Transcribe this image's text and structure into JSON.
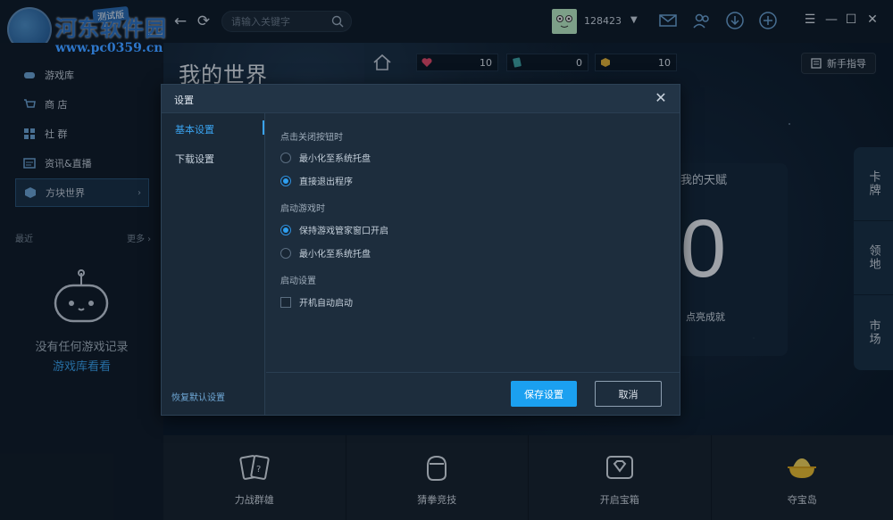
{
  "header": {
    "watermark": "河东软件园",
    "watermark_url": "www.pc0359.cn",
    "beta_tag": "测试版",
    "search_placeholder": "请输入关键字",
    "user_id": "128423"
  },
  "sidebar": {
    "items": [
      {
        "label": "游戏库",
        "icon": "gamepad-icon"
      },
      {
        "label": "商 店",
        "icon": "cart-icon"
      },
      {
        "label": "社 群",
        "icon": "community-icon"
      },
      {
        "label": "资讯&直播",
        "icon": "news-icon"
      },
      {
        "label": "方块世界",
        "icon": "cube-icon",
        "active": true
      }
    ],
    "recent_title": "最近",
    "recent_more": "更多 ›",
    "empty_text": "没有任何游戏记录",
    "empty_link": "游戏库看看"
  },
  "main": {
    "game_title": "我的世界",
    "resources": [
      {
        "icon": "heart-icon",
        "value": "10",
        "color": "#e84a6a"
      },
      {
        "icon": "card-gem-icon",
        "value": "0",
        "color": "#3fa6a6"
      },
      {
        "icon": "gold-block-icon",
        "value": "10",
        "color": "#e8b536"
      }
    ],
    "guide_label": "新手指导",
    "talent": {
      "title": "我的天赋",
      "value": "0",
      "subtitle": "点亮成就"
    },
    "side_tabs": [
      "卡牌",
      "领地",
      "市场"
    ],
    "bottom": [
      {
        "label": "力战群雄",
        "icon": "cards-icon"
      },
      {
        "label": "猜拳竞技",
        "icon": "fist-icon"
      },
      {
        "label": "开启宝箱",
        "icon": "chest-icon"
      },
      {
        "label": "夺宝岛",
        "icon": "gold-ingot-icon"
      }
    ]
  },
  "dialog": {
    "title": "设置",
    "nav": [
      "基本设置",
      "下载设置"
    ],
    "restore_defaults": "恢复默认设置",
    "sections": {
      "close_title": "点击关闭按钮时",
      "close_opt1": "最小化至系统托盘",
      "close_opt2": "直接退出程序",
      "launch_title": "启动游戏时",
      "launch_opt1": "保持游戏管家窗口开启",
      "launch_opt2": "最小化至系统托盘",
      "startup_title": "启动设置",
      "startup_opt1": "开机自动启动"
    },
    "selected": {
      "close": "直接退出程序",
      "launch": "保持游戏管家窗口开启",
      "startup_checked": false
    },
    "save_label": "保存设置",
    "cancel_label": "取消"
  },
  "colors": {
    "accent": "#1ba0f0",
    "link": "#3aa3f0",
    "panel": "#1d2d3d"
  }
}
